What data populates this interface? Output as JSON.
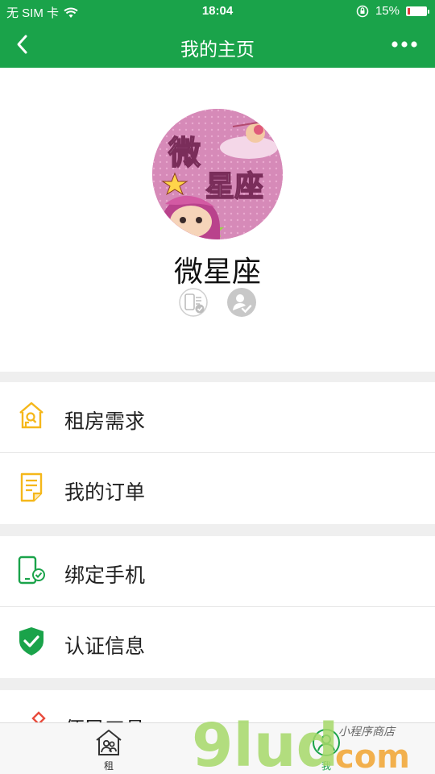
{
  "status_bar": {
    "carrier": "无 SIM 卡",
    "time": "18:04",
    "battery": "15%",
    "battery_level": 0.15
  },
  "nav": {
    "title": "我的主页",
    "back_icon": "chevron-left-icon",
    "more_icon": "more-dots-icon"
  },
  "profile": {
    "avatar_text_1": "微",
    "avatar_text_2": "星座",
    "name": "微星座",
    "badges": [
      "phone-verified-icon",
      "identity-verified-icon"
    ]
  },
  "menu": {
    "group1": [
      {
        "label": "租房需求",
        "icon": "house-search-icon"
      },
      {
        "label": "我的订单",
        "icon": "order-document-icon"
      }
    ],
    "group2": [
      {
        "label": "绑定手机",
        "icon": "phone-bind-icon"
      },
      {
        "label": "认证信息",
        "icon": "shield-check-icon"
      }
    ],
    "group3": [
      {
        "label": "便民工具",
        "icon": "tools-grid-icon"
      }
    ]
  },
  "tabbar": {
    "items": [
      {
        "label": "租",
        "icon": "rent-house-icon"
      },
      {
        "label": "我",
        "icon": "user-profile-icon"
      }
    ]
  },
  "watermark": {
    "brand": "9lud",
    "domain": "com",
    "tagline": "小程序商店"
  },
  "colors": {
    "primary": "#1aa34a",
    "accent_yellow": "#f5b71a",
    "background": "#efefef"
  }
}
